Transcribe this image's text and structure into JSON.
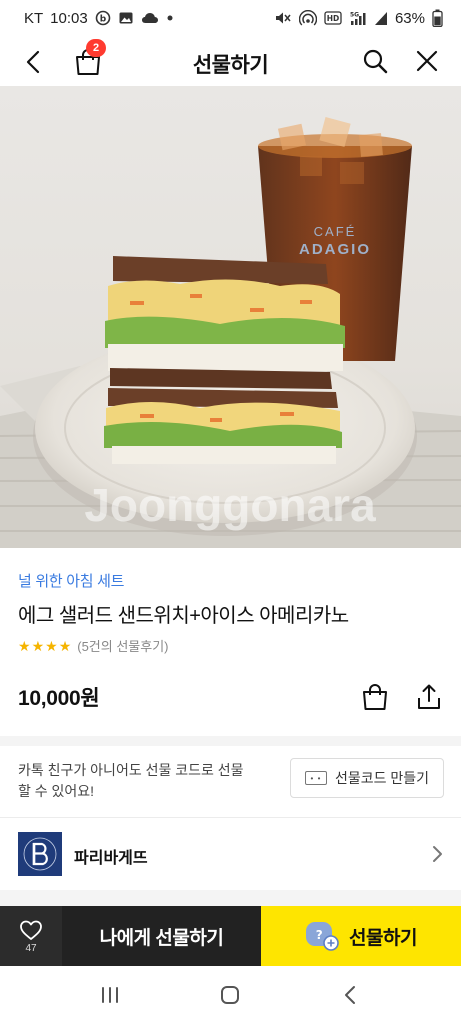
{
  "status_bar": {
    "carrier": "KT",
    "time": "10:03",
    "battery": "63%"
  },
  "header": {
    "title": "선물하기",
    "cart_badge": "2"
  },
  "product": {
    "image_watermark": "Joonggonara",
    "cup_brand_line1": "CAFÉ",
    "cup_brand_line2": "ADAGIO",
    "category": "널 위한 아침 세트",
    "name": "에그 샐러드 샌드위치+아이스 아메리카노",
    "rating_stars": 4,
    "review_text": "(5건의 선물후기)",
    "price": "10,000원"
  },
  "gift_code": {
    "description": "카톡 친구가 아니어도 선물 코드로 선물 할 수 있어요!",
    "button_label": "선물코드 만들기"
  },
  "brand": {
    "name": "파리바게뜨"
  },
  "actions": {
    "like_count": "47",
    "gift_self_label": "나에게 선물하기",
    "gift_label": "선물하기"
  },
  "colors": {
    "accent_yellow": "#fee500",
    "category_blue": "#3a7be0",
    "brand_navy": "#1f3b7a",
    "badge_red": "#ff3b30"
  }
}
